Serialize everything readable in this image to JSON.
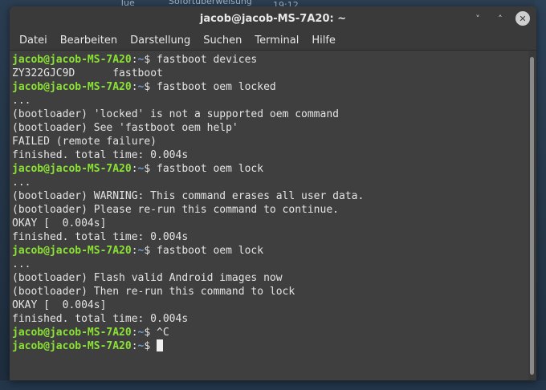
{
  "background": {
    "frag_tue": "Tue",
    "frag_transfer": "Sofortüberweisung",
    "frag_time": "19:12"
  },
  "window": {
    "title": "jacob@jacob-MS-7A20: ~",
    "controls": {
      "minimize_icon": "˅",
      "maximize_icon": "˄",
      "close_icon": "✕"
    }
  },
  "menu": [
    "Datei",
    "Bearbeiten",
    "Darstellung",
    "Suchen",
    "Terminal",
    "Hilfe"
  ],
  "terminal": {
    "prompt_user": "jacob@jacob-MS-7A20",
    "prompt_sep": ":",
    "prompt_path": "~",
    "prompt_dollar": "$ ",
    "lines": [
      {
        "type": "cmd",
        "text": "fastboot devices"
      },
      {
        "type": "out",
        "text": "ZY322GJC9D\tfastboot"
      },
      {
        "type": "cmd",
        "text": "fastboot oem locked"
      },
      {
        "type": "out",
        "text": "..."
      },
      {
        "type": "out",
        "text": "(bootloader) 'locked' is not a supported oem command"
      },
      {
        "type": "out",
        "text": "(bootloader) See 'fastboot oem help'"
      },
      {
        "type": "out",
        "text": "FAILED (remote failure)"
      },
      {
        "type": "out",
        "text": "finished. total time: 0.004s"
      },
      {
        "type": "cmd",
        "text": "fastboot oem lock"
      },
      {
        "type": "out",
        "text": "..."
      },
      {
        "type": "out",
        "text": "(bootloader) WARNING: This command erases all user data."
      },
      {
        "type": "out",
        "text": "(bootloader) Please re-run this command to continue."
      },
      {
        "type": "out",
        "text": "OKAY [  0.004s]"
      },
      {
        "type": "out",
        "text": "finished. total time: 0.004s"
      },
      {
        "type": "cmd",
        "text": "fastboot oem lock"
      },
      {
        "type": "out",
        "text": "..."
      },
      {
        "type": "out",
        "text": "(bootloader) Flash valid Android images now"
      },
      {
        "type": "out",
        "text": "(bootloader) Then re-run this command to lock"
      },
      {
        "type": "out",
        "text": "OKAY [  0.004s]"
      },
      {
        "type": "out",
        "text": "finished. total time: 0.004s"
      },
      {
        "type": "cmd",
        "text": "^C"
      },
      {
        "type": "cursor",
        "text": ""
      }
    ]
  }
}
